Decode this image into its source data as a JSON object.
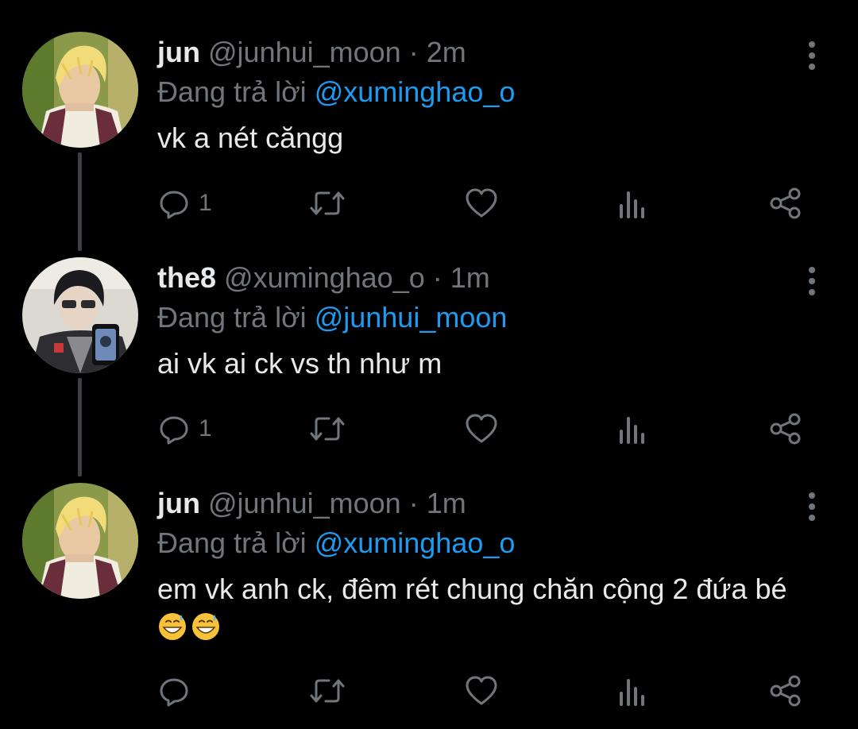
{
  "reply_prefix": "Đang trả lời",
  "tweets": [
    {
      "name": "jun",
      "handle": "@junhui_moon",
      "separator": "·",
      "time": "2m",
      "reply_to": "@xuminghao_o",
      "text": "vk a nét căngg",
      "reply_count": "1",
      "avatar": "jun-avatar"
    },
    {
      "name": "the8",
      "handle": "@xuminghao_o",
      "separator": "·",
      "time": "1m",
      "reply_to": "@junhui_moon",
      "text": "ai vk ai ck vs th như m",
      "reply_count": "1",
      "avatar": "the8-avatar"
    },
    {
      "name": "jun",
      "handle": "@junhui_moon",
      "separator": "·",
      "time": "1m",
      "reply_to": "@xuminghao_o",
      "text": "em vk anh ck, đêm rét chung chăn cộng 2 đứa bé",
      "reply_count": "",
      "emoji": "grinning-face-with-sweat",
      "avatar": "jun-avatar"
    }
  ],
  "icons": {
    "reply": "reply-icon",
    "retweet": "retweet-icon",
    "like": "heart-icon",
    "views": "views-icon",
    "share": "share-icon",
    "more": "more-vertical-icon"
  },
  "colors": {
    "background": "#000000",
    "text": "#e7e9ea",
    "muted": "#71767b",
    "accent": "#1d9bf0",
    "thread_line": "#3d4146"
  }
}
